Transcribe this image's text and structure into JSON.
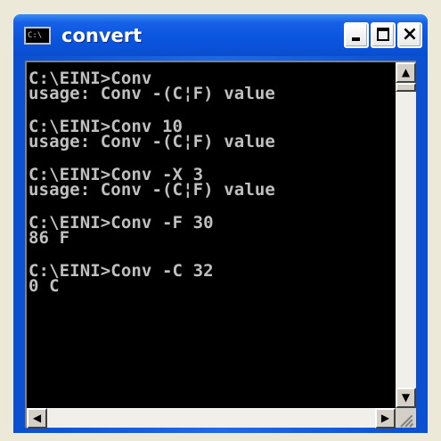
{
  "window": {
    "title": "convert",
    "icon_label": "C:\\",
    "icon": "console-icon",
    "colors": {
      "titlebar": "#0a55de",
      "console_bg": "#000000",
      "console_fg": "#c0c0c0"
    }
  },
  "title_buttons": {
    "minimize": "minimize-icon",
    "maximize": "maximize-icon",
    "close": "×"
  },
  "console": {
    "lines": [
      "",
      "C:\\EINI>Conv",
      "usage: Conv -(C¦F) value",
      "",
      "C:\\EINI>Conv 10",
      "usage: Conv -(C¦F) value",
      "",
      "C:\\EINI>Conv -X 3",
      "usage: Conv -(C¦F) value",
      "",
      "C:\\EINI>Conv -F 30",
      "86 F",
      "",
      "C:\\EINI>Conv -C 32",
      "0 C",
      ""
    ]
  },
  "scrollbars": {
    "up_arrow": "▲",
    "down_arrow": "▼",
    "left_arrow": "◀",
    "right_arrow": "▶"
  }
}
